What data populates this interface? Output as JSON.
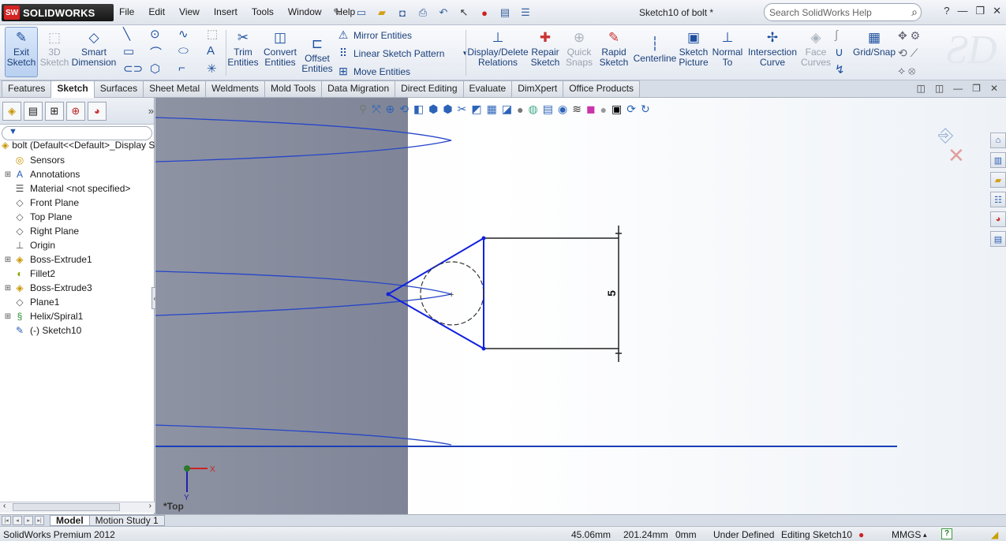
{
  "app": {
    "logo_text": "SOLIDWORKS",
    "logo_short": "SW",
    "title": "Sketch10 of bolt *",
    "search_placeholder": "Search SolidWorks Help",
    "help_label": "?"
  },
  "menu": [
    "File",
    "Edit",
    "View",
    "Insert",
    "Tools",
    "Window",
    "Help"
  ],
  "ribbon": {
    "exit_sketch": "Exit Sketch",
    "sketch_3d": "3D Sketch",
    "smart_dimension": "Smart Dimension",
    "trim_entities": "Trim Entities",
    "convert_entities": "Convert Entities",
    "offset_entities": "Offset Entities",
    "mirror_entities": "Mirror Entities",
    "linear_sketch_pattern": "Linear Sketch Pattern",
    "move_entities": "Move Entities",
    "display_delete_relations": "Display/Delete Relations",
    "repair_sketch": "Repair Sketch",
    "quick_snaps": "Quick Snaps",
    "rapid_sketch": "Rapid Sketch",
    "centerline": "Centerline",
    "sketch_picture": "Sketch Picture",
    "normal_to": "Normal To",
    "intersection_curve": "Intersection Curve",
    "face_curves": "Face Curves",
    "grid_snap": "Grid/Snap"
  },
  "tabs": [
    "Features",
    "Sketch",
    "Surfaces",
    "Sheet Metal",
    "Weldments",
    "Mold Tools",
    "Data Migration",
    "Direct Editing",
    "Evaluate",
    "DimXpert",
    "Office Products"
  ],
  "active_tab": "Sketch",
  "feature_tree": {
    "root": "bolt  (Default<<Default>_Display S",
    "items": [
      {
        "label": "Sensors",
        "icon": "sensor-icon",
        "expandable": false
      },
      {
        "label": "Annotations",
        "icon": "annotations-icon",
        "expandable": true
      },
      {
        "label": "Material <not specified>",
        "icon": "material-icon",
        "expandable": false
      },
      {
        "label": "Front Plane",
        "icon": "plane-icon",
        "expandable": false
      },
      {
        "label": "Top Plane",
        "icon": "plane-icon",
        "expandable": false
      },
      {
        "label": "Right Plane",
        "icon": "plane-icon",
        "expandable": false
      },
      {
        "label": "Origin",
        "icon": "origin-icon",
        "expandable": false
      },
      {
        "label": "Boss-Extrude1",
        "icon": "extrude-icon",
        "expandable": true
      },
      {
        "label": "Fillet2",
        "icon": "fillet-icon",
        "expandable": false
      },
      {
        "label": "Boss-Extrude3",
        "icon": "extrude-icon",
        "expandable": true
      },
      {
        "label": "Plane1",
        "icon": "plane-icon",
        "expandable": false
      },
      {
        "label": "Helix/Spiral1",
        "icon": "helix-icon",
        "expandable": true
      },
      {
        "label": "(-) Sketch10",
        "icon": "sketch-icon",
        "expandable": false
      }
    ]
  },
  "viewport": {
    "view_label": "*Top",
    "dimension_value": "5",
    "axis_x": "X",
    "axis_y": "Y"
  },
  "bottom_tabs": [
    "Model",
    "Motion Study 1"
  ],
  "status": {
    "product": "SolidWorks Premium 2012",
    "x": "45.06mm",
    "y": "201.24mm",
    "z": "0mm",
    "state": "Under Defined",
    "editing": "Editing Sketch10",
    "units": "MMGS",
    "units_arrow": "▴"
  }
}
